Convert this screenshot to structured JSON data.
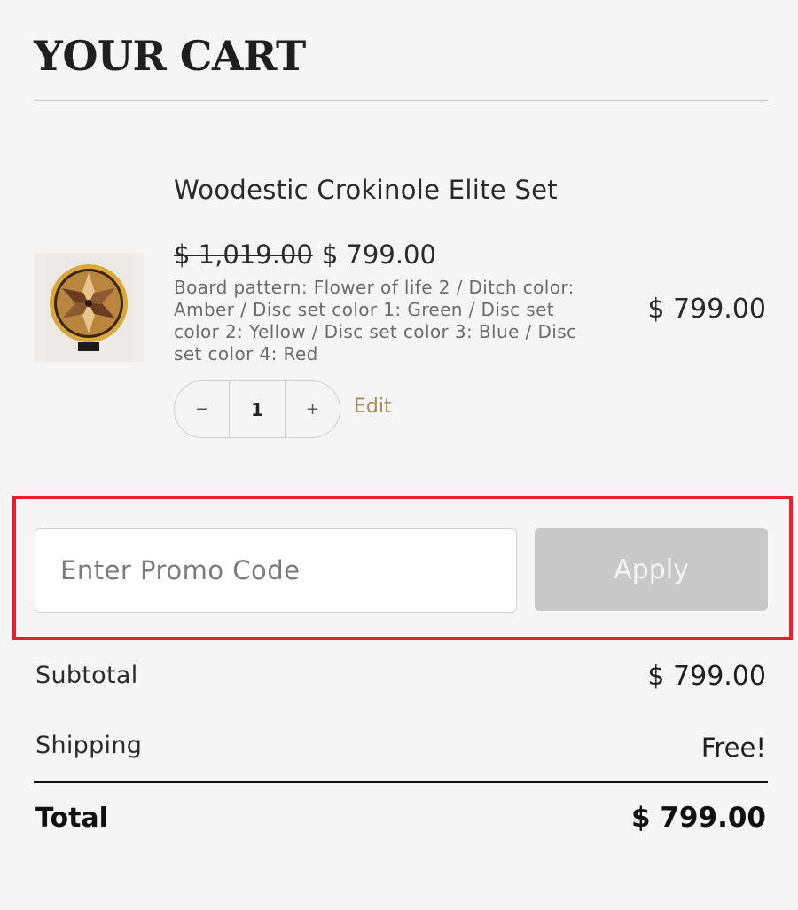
{
  "header": {
    "title": "YOUR CART"
  },
  "item": {
    "image_alt": "crokinole-board-icon",
    "name": "Woodestic Crokinole Elite Set",
    "original_price": "$ 1,019.00",
    "sale_price": "$ 799.00",
    "options": "Board pattern: Flower of life 2 / Ditch color: Amber / Disc set color 1: Green / Disc set color 2: Yellow / Disc set color 3: Blue / Disc set color 4: Red",
    "line_total": "$ 799.00",
    "quantity": "1",
    "decrement_label": "−",
    "increment_label": "+",
    "edit_label": "Edit"
  },
  "promo": {
    "placeholder": "Enter Promo Code",
    "value": "",
    "apply_label": "Apply"
  },
  "summary": {
    "subtotal_label": "Subtotal",
    "subtotal_value": "$ 799.00",
    "shipping_label": "Shipping",
    "shipping_value": "Free!",
    "total_label": "Total",
    "total_value": "$ 799.00"
  },
  "colors": {
    "background": "#f6f5f5",
    "accent_link": "#a38d5c",
    "highlight_border": "#e8202a",
    "apply_disabled": "#c8c8c8"
  }
}
